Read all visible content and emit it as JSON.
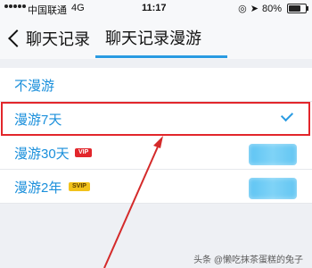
{
  "status_bar": {
    "carrier": "中国联通",
    "network": "4G",
    "time": "11:17",
    "battery_percent_text": "80%",
    "battery_level": 0.8
  },
  "nav": {
    "back_label": "聊天记录",
    "title": "聊天记录漫游",
    "accent_color": "#2a9be2"
  },
  "options": [
    {
      "label": "不漫游"
    },
    {
      "label": "漫游7天",
      "selected": true
    },
    {
      "label": "漫游30天",
      "badge": "VIP"
    },
    {
      "label": "漫游2年",
      "badge": "SVIP"
    }
  ],
  "watermark": "头条 @懒吃抹茶蛋糕的兔子",
  "colors": {
    "label_blue": "#1a8fdb",
    "highlight_red": "#e2262b",
    "vip_red": "#e2262b",
    "svip_gold": "#f2c21b",
    "toggle_blue": "#62c5f2"
  }
}
